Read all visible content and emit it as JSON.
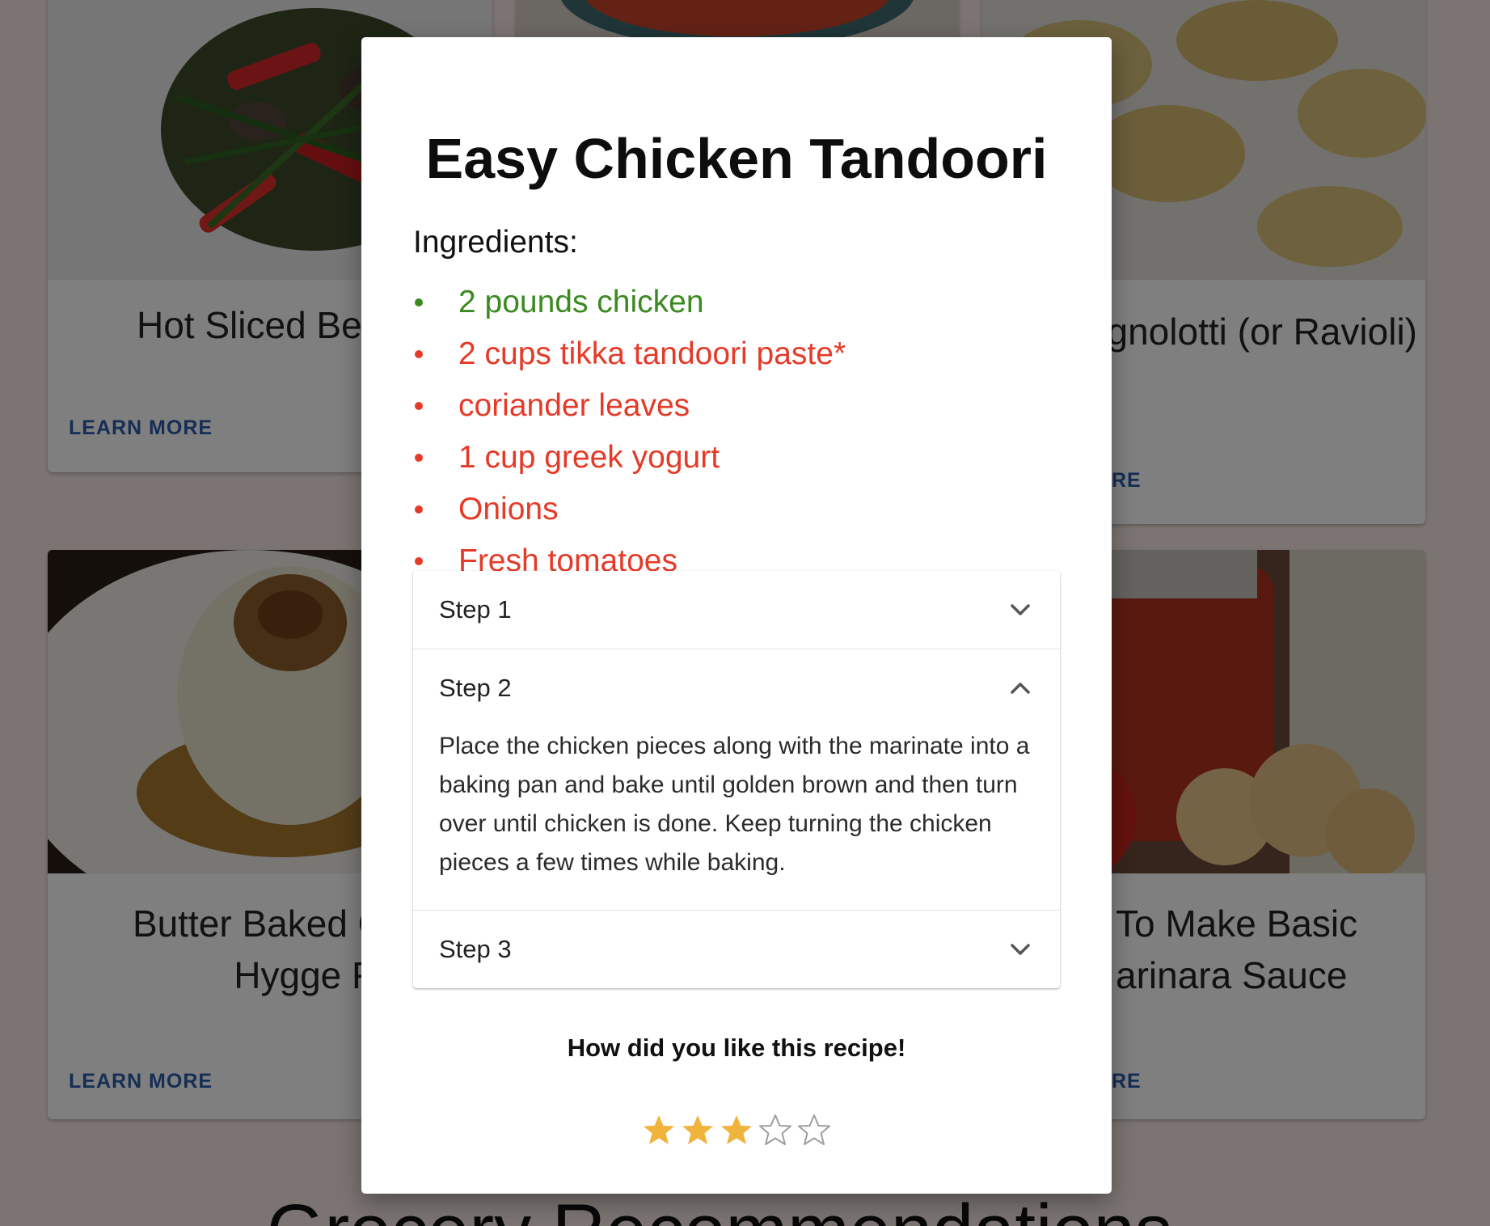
{
  "background_cards": [
    {
      "title": "Hot Sliced Be",
      "link": "LEARN MORE"
    },
    {
      "title": "ed\" Agnolotti (or Ravioli)",
      "link": "RE"
    },
    {
      "title": "Butter Baked On Pure Hygge Fo",
      "link": "LEARN MORE"
    },
    {
      "title": "To Make Basic arinara Sauce",
      "link": "RE"
    }
  ],
  "background_heading": "Grocery Recommendations",
  "modal": {
    "title": "Easy Chicken Tandoori",
    "ingredients_label": "Ingredients:",
    "ingredients": [
      {
        "text": "2 pounds chicken",
        "status": "have"
      },
      {
        "text": "2 cups tikka tandoori paste*",
        "status": "missing"
      },
      {
        "text": "coriander leaves",
        "status": "missing"
      },
      {
        "text": "1 cup greek yogurt",
        "status": "missing"
      },
      {
        "text": "Onions",
        "status": "missing"
      },
      {
        "text": "Fresh tomatoes",
        "status": "missing"
      }
    ],
    "steps": [
      {
        "label": "Step 1",
        "expanded": false,
        "icon": "chevron-down-icon",
        "body": ""
      },
      {
        "label": "Step 2",
        "expanded": true,
        "icon": "chevron-up-icon",
        "body": "Place the chicken pieces along with the marinate into a baking pan and bake until golden brown and then turn over until chicken is done. Keep turning the chicken pieces a few times while baking."
      },
      {
        "label": "Step 3",
        "expanded": false,
        "icon": "chevron-down-icon",
        "body": ""
      }
    ],
    "rating_prompt": "How did you like this recipe!",
    "rating": {
      "value": 3,
      "max": 5
    }
  },
  "colors": {
    "have": "#3a8a1f",
    "missing": "#e53a28",
    "star_filled": "#f0b43c",
    "star_empty": "#9e9e9e",
    "link": "#2a5dab"
  }
}
